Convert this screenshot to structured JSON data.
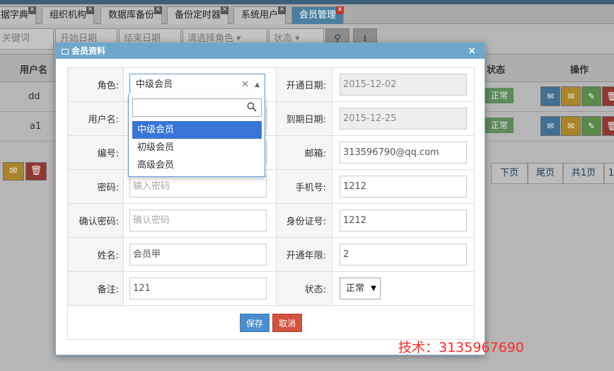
{
  "tabs": [
    {
      "label": "据字典"
    },
    {
      "label": "组织机构"
    },
    {
      "label": "数据库备份"
    },
    {
      "label": "备份定时器"
    },
    {
      "label": "系统用户"
    },
    {
      "label": "会员管理"
    }
  ],
  "toolbar": {
    "keyword_placeholder": "关键词",
    "start_date_placeholder": "开始日期",
    "end_date_placeholder": "结束日期",
    "role_select": "请选择角色",
    "status_select": "状态"
  },
  "grid": {
    "headers": {
      "username": "用户名",
      "status": "状态",
      "operations": "操作"
    },
    "rows": [
      {
        "username": "dd",
        "status": "正常"
      },
      {
        "username": "a1",
        "status": "正常"
      }
    ]
  },
  "pager": {
    "next": "下页",
    "last": "尾页",
    "total": "共1页",
    "page": "1"
  },
  "modal": {
    "title": "会员资料",
    "close": "×",
    "fields": {
      "role_label": "角色:",
      "role_value": "中级会员",
      "open_date_label": "开通日期:",
      "open_date_value": "2015-12-02",
      "username_label": "用户名:",
      "expire_date_label": "到期日期:",
      "expire_date_value": "2015-12-25",
      "number_label": "编号:",
      "email_label": "邮箱:",
      "email_value": "313596790@qq.com",
      "password_label": "密码:",
      "password_placeholder": "输入密码",
      "phone_label": "手机号:",
      "phone_value": "1212",
      "confirm_label": "确认密码:",
      "confirm_placeholder": "确认密码",
      "idcard_label": "身份证号:",
      "idcard_value": "1212",
      "name_label": "姓名:",
      "name_value": "会员甲",
      "years_label": "开通年限:",
      "years_value": "2",
      "remark_label": "备注:",
      "remark_value": "121",
      "status_label": "状态:",
      "status_value": "正常"
    },
    "role_options": [
      "中级会员",
      "初级会员",
      "高级会员"
    ],
    "save": "保存",
    "cancel": "取消"
  },
  "watermark": "技术：3135967690"
}
